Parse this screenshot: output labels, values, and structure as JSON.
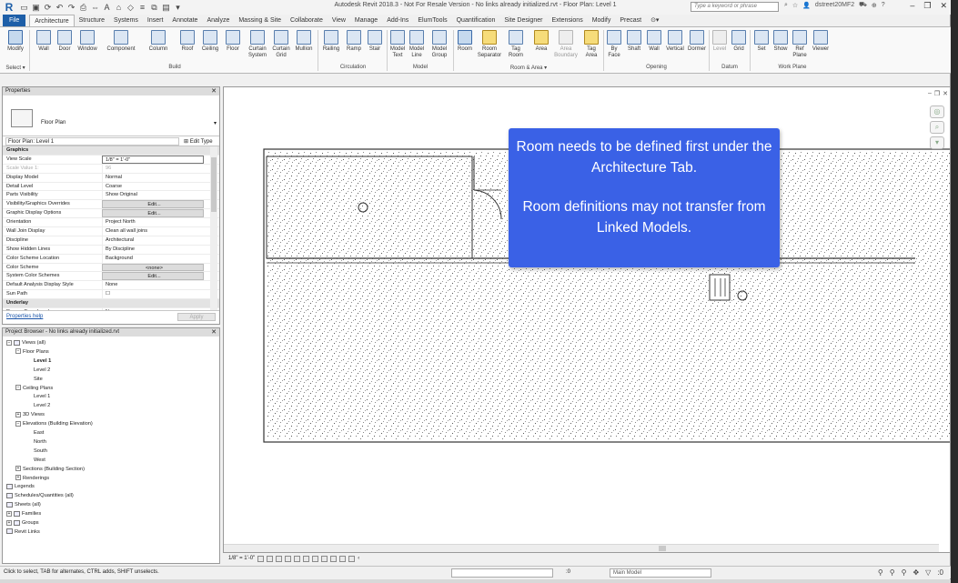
{
  "window": {
    "title": "Autodesk Revit 2018.3 - Not For Resale Version -   No links already initialized.rvt - Floor Plan: Level 1",
    "search_placeholder": "Type a keyword or phrase",
    "username": "dstreet20MF2"
  },
  "ribbon": {
    "tabs": [
      "File",
      "Architecture",
      "Structure",
      "Systems",
      "Insert",
      "Annotate",
      "Analyze",
      "Massing & Site",
      "Collaborate",
      "View",
      "Manage",
      "Add-Ins",
      "ElumTools",
      "Quantification",
      "Site Designer",
      "Extensions",
      "Modify",
      "Precast"
    ],
    "active_tab": "Architecture",
    "buttons": {
      "modify": "Modify",
      "wall": "Wall",
      "door": "Door",
      "window": "Window",
      "component": "Component",
      "column": "Column",
      "roof": "Roof",
      "ceiling": "Ceiling",
      "floor": "Floor",
      "curtain_system_1": "Curtain",
      "curtain_system_2": "System",
      "curtain_grid_1": "Curtain",
      "curtain_grid_2": "Grid",
      "mullion": "Mullion",
      "railing": "Railing",
      "ramp": "Ramp",
      "stair": "Stair",
      "model_text_1": "Model",
      "model_text_2": "Text",
      "model_line_1": "Model",
      "model_line_2": "Line",
      "model_group_1": "Model",
      "model_group_2": "Group",
      "room": "Room",
      "room_separator_1": "Room",
      "room_separator_2": "Separator",
      "tag_room_1": "Tag",
      "tag_room_2": "Room",
      "area": "Area",
      "area_boundary_1": "Area",
      "area_boundary_2": "Boundary",
      "tag_area_1": "Tag",
      "tag_area_2": "Area",
      "by_face_1": "By",
      "by_face_2": "Face",
      "shaft": "Shaft",
      "open_wall": "Wall",
      "vertical": "Vertical",
      "dormer": "Dormer",
      "level": "Level",
      "grid": "Grid",
      "set": "Set",
      "show": "Show",
      "ref_plane_1": "Ref",
      "ref_plane_2": "Plane",
      "viewer": "Viewer"
    },
    "panels": {
      "select": "Select ▾",
      "build": "Build",
      "circulation": "Circulation",
      "model": "Model",
      "room_area": "Room & Area ▾",
      "opening": "Opening",
      "datum": "Datum",
      "work_plane": "Work Plane"
    }
  },
  "properties": {
    "header": "Properties",
    "type_name": "Floor Plan",
    "instance": "Floor Plan: Level 1",
    "edit_type": "Edit Type",
    "rows": [
      {
        "k": "Graphics",
        "v": "",
        "group": true
      },
      {
        "k": "View Scale",
        "v": "1/8\" = 1'-0\"",
        "box": true
      },
      {
        "k": "Scale Value    1:",
        "v": "96",
        "dis": true
      },
      {
        "k": "Display Model",
        "v": "Normal"
      },
      {
        "k": "Detail Level",
        "v": "Coarse"
      },
      {
        "k": "Parts Visibility",
        "v": "Show Original"
      },
      {
        "k": "Visibility/Graphics Overrides",
        "v": "Edit...",
        "btn": true
      },
      {
        "k": "Graphic Display Options",
        "v": "Edit...",
        "btn": true
      },
      {
        "k": "Orientation",
        "v": "Project North"
      },
      {
        "k": "Wall Join Display",
        "v": "Clean all wall joins"
      },
      {
        "k": "Discipline",
        "v": "Architectural"
      },
      {
        "k": "Show Hidden Lines",
        "v": "By Discipline"
      },
      {
        "k": "Color Scheme Location",
        "v": "Background"
      },
      {
        "k": "Color Scheme",
        "v": "<none>",
        "btn": true
      },
      {
        "k": "System Color Schemes",
        "v": "Edit...",
        "btn": true
      },
      {
        "k": "Default Analysis Display Style",
        "v": "None"
      },
      {
        "k": "Sun Path",
        "v": "☐"
      },
      {
        "k": "Underlay",
        "v": "",
        "group": true
      },
      {
        "k": "Range: Base Level",
        "v": "None"
      }
    ],
    "help": "Properties help",
    "apply": "Apply"
  },
  "browser": {
    "header": "Project Browser - No links already initialized.rvt",
    "nodes": [
      {
        "t": "Views (all)",
        "d": 0,
        "tg": "−",
        "icon": true
      },
      {
        "t": "Floor Plans",
        "d": 1,
        "tg": "−"
      },
      {
        "t": "Level 1",
        "d": 3,
        "bold": true
      },
      {
        "t": "Level 2",
        "d": 3
      },
      {
        "t": "Site",
        "d": 3
      },
      {
        "t": "Ceiling Plans",
        "d": 1,
        "tg": "−"
      },
      {
        "t": "Level 1",
        "d": 3
      },
      {
        "t": "Level 2",
        "d": 3
      },
      {
        "t": "3D Views",
        "d": 1,
        "tg": "+"
      },
      {
        "t": "Elevations (Building Elevation)",
        "d": 1,
        "tg": "−"
      },
      {
        "t": "East",
        "d": 3
      },
      {
        "t": "North",
        "d": 3
      },
      {
        "t": "South",
        "d": 3
      },
      {
        "t": "West",
        "d": 3
      },
      {
        "t": "Sections (Building Section)",
        "d": 1,
        "tg": "+"
      },
      {
        "t": "Renderings",
        "d": 1,
        "tg": "+"
      },
      {
        "t": "Legends",
        "d": 0,
        "icon": true
      },
      {
        "t": "Schedules/Quantities (all)",
        "d": 0,
        "icon": true
      },
      {
        "t": "Sheets (all)",
        "d": 0,
        "icon": true
      },
      {
        "t": "Families",
        "d": 0,
        "tg": "+",
        "icon": true
      },
      {
        "t": "Groups",
        "d": 0,
        "tg": "+",
        "icon": true
      },
      {
        "t": "Revit Links",
        "d": 0,
        "icon": true
      }
    ]
  },
  "callout": {
    "line1": "Room needs to be defined first under the Architecture Tab.",
    "line2": "Room definitions may not transfer from Linked Models."
  },
  "view_control": {
    "scale": "1/8\" = 1'-0\""
  },
  "status": {
    "message": "Click to select, TAB for alternates, CTRL adds, SHIFT unselects.",
    "zero": ":0",
    "model": "Main Model"
  },
  "colors": {
    "callout_bg": "#3a61e6",
    "file_tab": "#1e5fa8"
  }
}
